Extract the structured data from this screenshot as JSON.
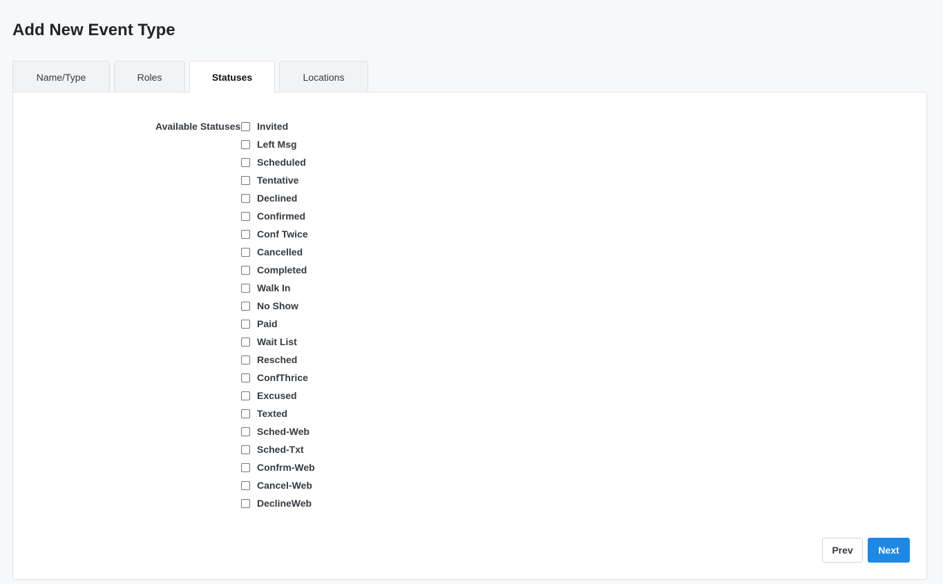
{
  "page": {
    "title": "Add New Event Type"
  },
  "tabs": [
    {
      "label": "Name/Type",
      "active": false
    },
    {
      "label": "Roles",
      "active": false
    },
    {
      "label": "Statuses",
      "active": true
    },
    {
      "label": "Locations",
      "active": false
    }
  ],
  "statuses": {
    "field_label": "Available Statuses",
    "items": [
      {
        "label": "Invited",
        "checked": false
      },
      {
        "label": "Left Msg",
        "checked": false
      },
      {
        "label": "Scheduled",
        "checked": false
      },
      {
        "label": "Tentative",
        "checked": false
      },
      {
        "label": "Declined",
        "checked": false
      },
      {
        "label": "Confirmed",
        "checked": false
      },
      {
        "label": "Conf Twice",
        "checked": false
      },
      {
        "label": "Cancelled",
        "checked": false
      },
      {
        "label": "Completed",
        "checked": false
      },
      {
        "label": "Walk In",
        "checked": false
      },
      {
        "label": "No Show",
        "checked": false
      },
      {
        "label": "Paid",
        "checked": false
      },
      {
        "label": "Wait List",
        "checked": false
      },
      {
        "label": "Resched",
        "checked": false
      },
      {
        "label": "ConfThrice",
        "checked": false
      },
      {
        "label": "Excused",
        "checked": false
      },
      {
        "label": "Texted",
        "checked": false
      },
      {
        "label": "Sched-Web",
        "checked": false
      },
      {
        "label": "Sched-Txt",
        "checked": false
      },
      {
        "label": "Confrm-Web",
        "checked": false
      },
      {
        "label": "Cancel-Web",
        "checked": false
      },
      {
        "label": "DeclineWeb",
        "checked": false
      }
    ]
  },
  "actions": {
    "prev_label": "Prev",
    "next_label": "Next"
  },
  "colors": {
    "primary": "#1e88e5",
    "background": "#f7f8fa",
    "panel": "#ffffff",
    "border": "#dee2e6"
  }
}
